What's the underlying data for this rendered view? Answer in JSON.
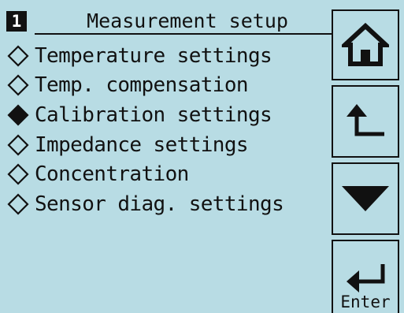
{
  "header": {
    "page_number": "1",
    "title": "Measurement setup"
  },
  "menu": {
    "items": [
      {
        "label": "Temperature settings",
        "selected": false
      },
      {
        "label": "Temp. compensation",
        "selected": false
      },
      {
        "label": "Calibration settings",
        "selected": true
      },
      {
        "label": "Impedance settings",
        "selected": false
      },
      {
        "label": "Concentration",
        "selected": false
      },
      {
        "label": "Sensor diag. settings",
        "selected": false
      }
    ]
  },
  "buttons": {
    "home_icon": "home-icon",
    "back_icon": "return-arrow-icon",
    "down_icon": "down-triangle-icon",
    "enter_icon": "enter-arrow-icon",
    "enter_label": "Enter"
  },
  "colors": {
    "background": "#b8dce4",
    "foreground": "#111111"
  }
}
